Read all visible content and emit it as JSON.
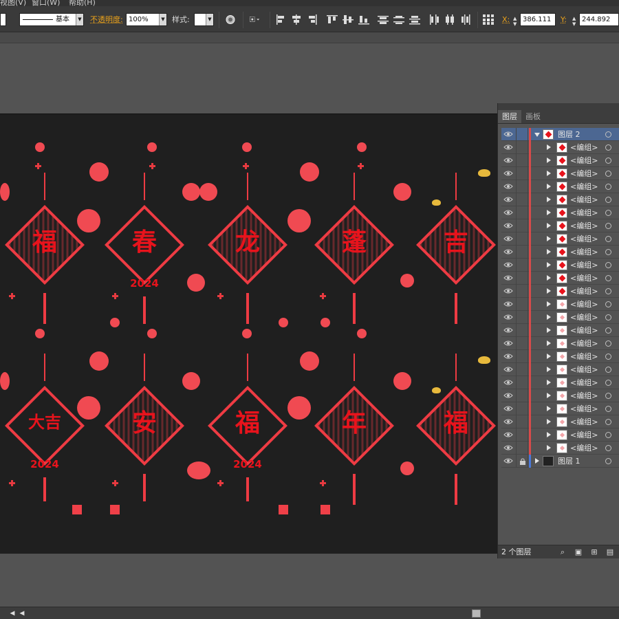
{
  "menu": {
    "item1": "视图(V)",
    "item2": "窗口(W)",
    "item3": "帮助(H)"
  },
  "control_bar": {
    "stroke_profile": "基本",
    "opacity_label": "不透明度:",
    "opacity_value": "100%",
    "style_label": "样式:",
    "x_label": "X:",
    "x_value": "386.111",
    "y_label": "Y:",
    "y_value": "244.892"
  },
  "ornaments": {
    "row1": [
      {
        "glyph": "福",
        "year": ""
      },
      {
        "glyph": "春",
        "year": "2024"
      },
      {
        "glyph": "龙",
        "year": ""
      },
      {
        "glyph": "蓬",
        "year": ""
      },
      {
        "glyph": "吉",
        "year": ""
      }
    ],
    "row2": [
      {
        "glyph": "大吉",
        "year": "2024"
      },
      {
        "glyph": "安",
        "year": ""
      },
      {
        "glyph": "福",
        "year": "2024"
      },
      {
        "glyph": "年",
        "year": ""
      },
      {
        "glyph": "福",
        "year": ""
      }
    ]
  },
  "layers_panel": {
    "tab_layers": "图层",
    "tab_artboards": "画板",
    "layer2_name": "图层 2",
    "group_label": "<编组>",
    "layer1_name": "图层 1",
    "footer_count": "2 个图层"
  },
  "colors": {
    "ornament_red": "#ee3b43",
    "layer2_color": "#d94a4a",
    "layer1_color": "#4a78d9",
    "selection": "#4c6792"
  }
}
